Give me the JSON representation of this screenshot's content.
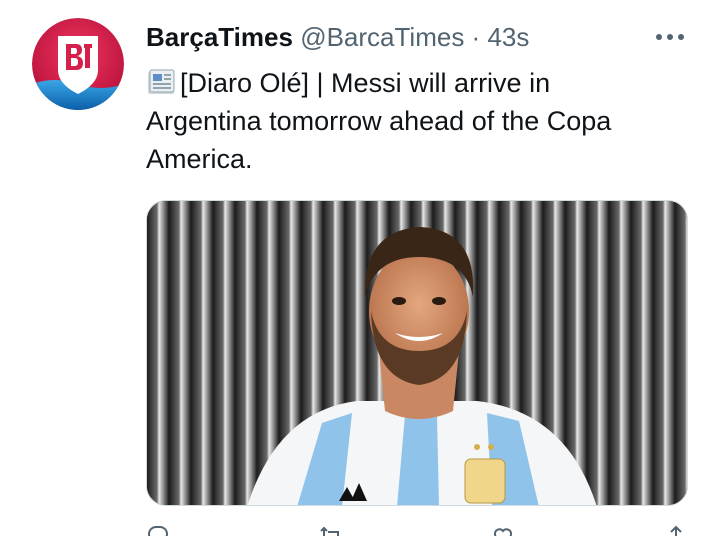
{
  "tweet": {
    "display_name": "BarçaTimes",
    "handle": "@BarcaTimes",
    "separator": "·",
    "time": "43s",
    "more_glyph": "•••",
    "text": "[Diaro Olé] | Messi will arrive in Argentina tomorrow ahead of the Copa America.",
    "media_alt": "Messi smiling in Argentina jersey",
    "avatar_icon": "barcatimes-logo",
    "text_icon": "newspaper-icon"
  },
  "colors": {
    "text": "#0f1419",
    "secondary": "#536471",
    "border": "#cfd9de",
    "avatar_red": "#d61f4a",
    "jersey_blue": "#8fc3ea"
  }
}
